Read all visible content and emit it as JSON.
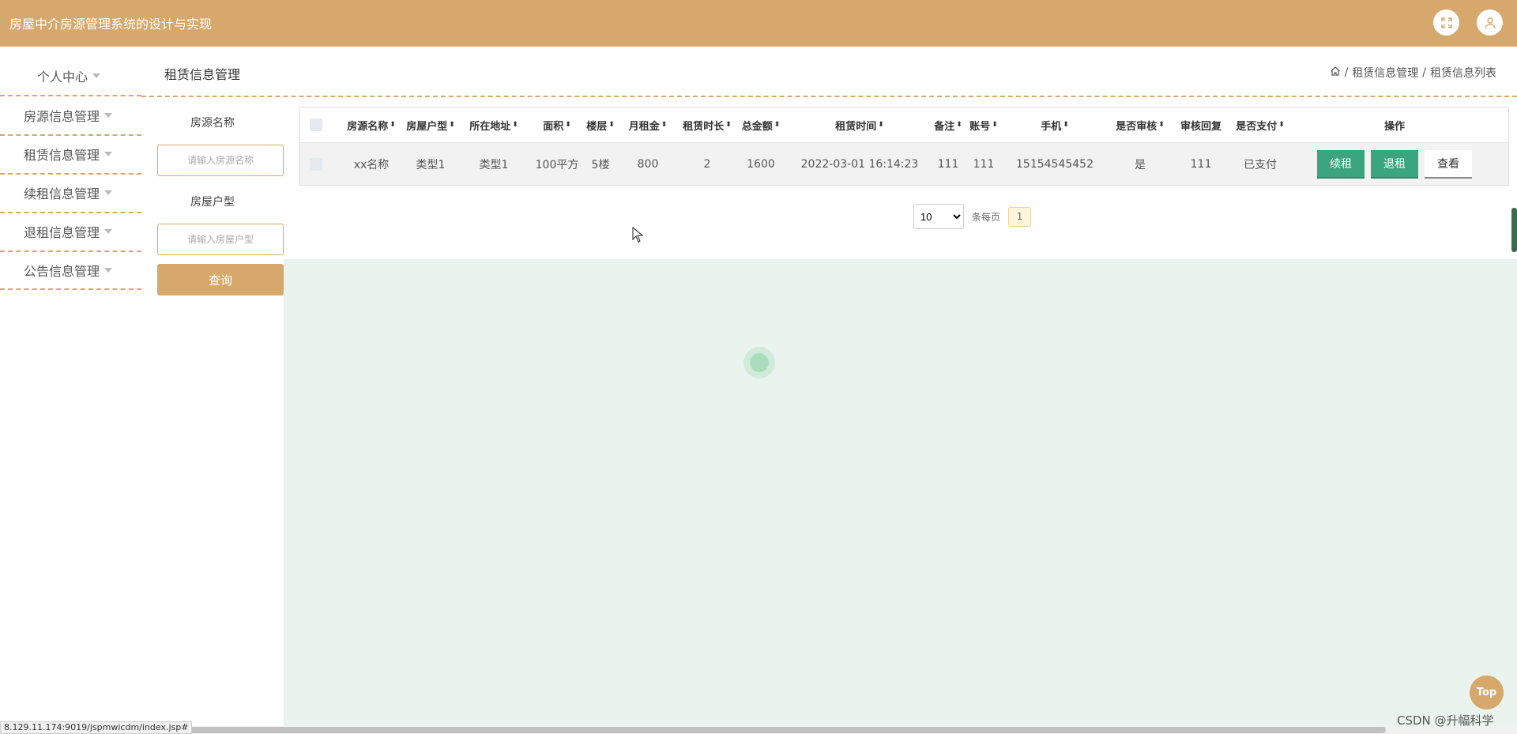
{
  "app": {
    "title": "房屋中介房源管理系统的设计与实现"
  },
  "topbar": {
    "fullscreen_icon": "fullscreen-icon",
    "user_icon": "user-icon"
  },
  "sidebar": {
    "items": [
      {
        "label": "个人中心"
      },
      {
        "label": "房源信息管理"
      },
      {
        "label": "租赁信息管理"
      },
      {
        "label": "续租信息管理"
      },
      {
        "label": "退租信息管理"
      },
      {
        "label": "公告信息管理"
      }
    ]
  },
  "header": {
    "page_title": "租赁信息管理",
    "breadcrumb": [
      "租赁信息管理",
      "租赁信息列表"
    ]
  },
  "filters": {
    "name_label": "房源名称",
    "name_placeholder": "请输入房源名称",
    "type_label": "房屋户型",
    "type_placeholder": "请输入房屋户型",
    "query_label": "查询"
  },
  "table": {
    "columns": [
      "房源名称",
      "房屋户型",
      "所在地址",
      "面积",
      "楼层",
      "月租金",
      "租赁时长",
      "总金额",
      "租赁时间",
      "备注",
      "账号",
      "手机",
      "是否审核",
      "审核回复",
      "是否支付",
      "操作"
    ],
    "rows": [
      {
        "cells": [
          "xx名称",
          "类型1",
          "类型1",
          "100平方",
          "5楼",
          "800",
          "2",
          "1600",
          "2022-03-01 16:14:23",
          "111",
          "111",
          "15154545452",
          "是",
          "111",
          "已支付"
        ],
        "actions": [
          "续租",
          "退租",
          "查看"
        ]
      }
    ]
  },
  "pager": {
    "page_size": "10",
    "per_page_label": "条每页",
    "current_page": "1"
  },
  "top_button": "Top",
  "status_url": "8.129.11.174:9019/jspmwicdm/index.jsp#",
  "watermark": "CSDN @升幅科学",
  "colors": {
    "accent": "#d6a86c",
    "action_green": "#3aa57e",
    "content_bg": "#ebf3ef"
  }
}
